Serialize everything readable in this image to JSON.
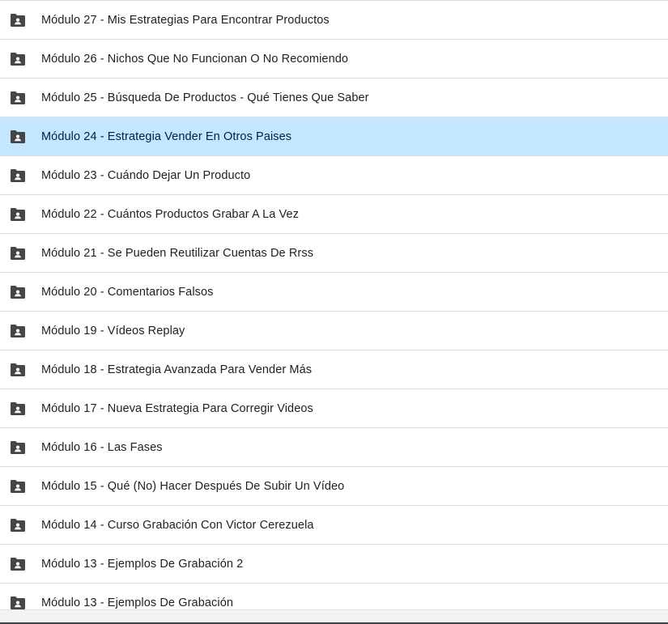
{
  "selected_index": 3,
  "colors": {
    "selected_background": "#c2e7ff",
    "divider": "#dadce0",
    "icon": "#444746"
  },
  "rows": [
    {
      "icon": "shared-folder-icon",
      "label": "Módulo 27 - Mis Estrategias Para Encontrar Productos"
    },
    {
      "icon": "shared-folder-icon",
      "label": "Módulo 26 - Nichos Que No Funcionan O No Recomiendo"
    },
    {
      "icon": "shared-folder-icon",
      "label": "Módulo 25 - Búsqueda De Productos - Qué Tienes Que Saber"
    },
    {
      "icon": "shared-folder-icon",
      "label": "Módulo 24 - Estrategia Vender En Otros Paises"
    },
    {
      "icon": "shared-folder-icon",
      "label": "Módulo 23 - Cuándo Dejar Un Producto"
    },
    {
      "icon": "shared-folder-icon",
      "label": "Módulo 22 - Cuántos Productos Grabar A La Vez"
    },
    {
      "icon": "shared-folder-icon",
      "label": "Módulo 21 - Se Pueden Reutilizar Cuentas De Rrss"
    },
    {
      "icon": "shared-folder-icon",
      "label": "Módulo 20 - Comentarios Falsos"
    },
    {
      "icon": "shared-folder-icon",
      "label": "Módulo 19 - Vídeos Replay"
    },
    {
      "icon": "shared-folder-icon",
      "label": "Módulo 18 - Estrategia Avanzada Para Vender Más"
    },
    {
      "icon": "shared-folder-icon",
      "label": "Módulo 17 - Nueva Estrategia Para Corregir Videos"
    },
    {
      "icon": "shared-folder-icon",
      "label": "Módulo 16 - Las Fases"
    },
    {
      "icon": "shared-folder-icon",
      "label": "Módulo 15 - Qué (No) Hacer Después De Subir Un Vídeo"
    },
    {
      "icon": "shared-folder-icon",
      "label": "Módulo 14 - Curso Grabación Con Victor Cerezuela"
    },
    {
      "icon": "shared-folder-icon",
      "label": "Módulo 13 - Ejemplos De Grabación 2"
    },
    {
      "icon": "shared-folder-icon",
      "label": "Módulo 13 - Ejemplos De Grabación"
    }
  ]
}
